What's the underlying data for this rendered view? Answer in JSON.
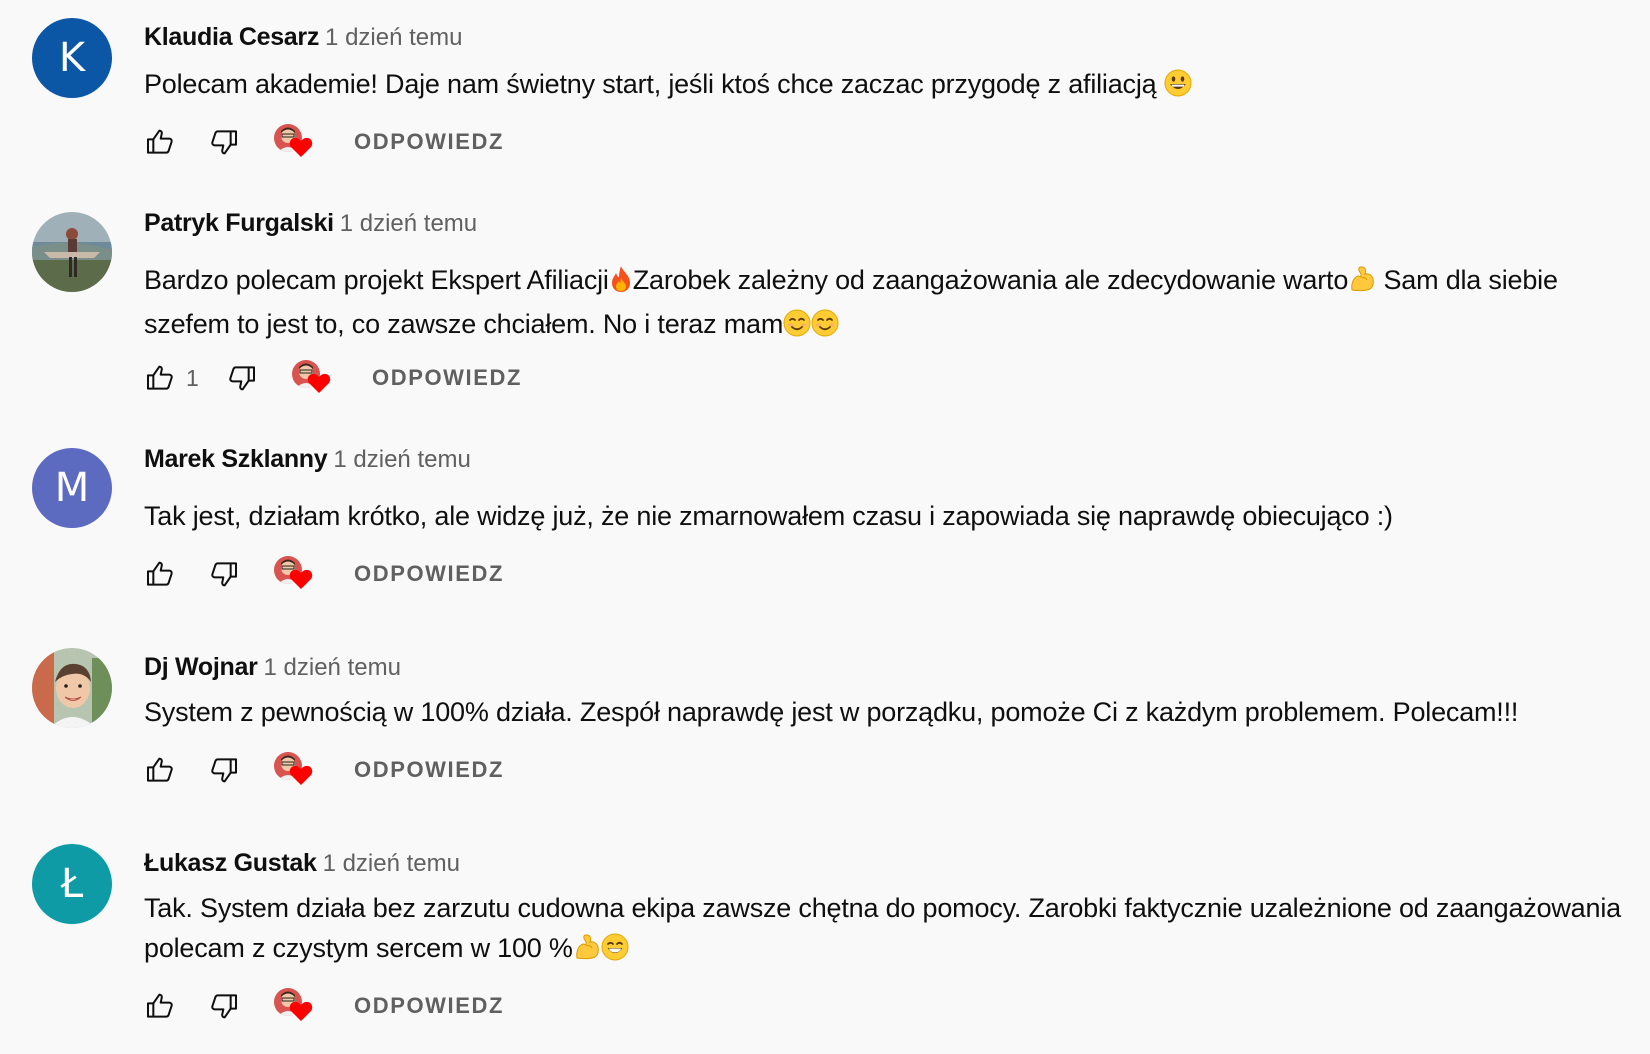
{
  "reply_label": "ODPOWIEDZ",
  "colors": {
    "background": "#f9f9f9",
    "text_primary": "#0f0f0f",
    "text_secondary": "#606060",
    "heart": "#ff0000"
  },
  "comments": [
    {
      "author": "Klaudia Cesarz",
      "time": "1 dzień temu",
      "avatar_letter": "K",
      "avatar_color": "#0b57a6",
      "text_parts": [
        "Polecam akademie! Daje nam świetny start, jeśli ktoś chce zaczac przygodę z afiliacją "
      ],
      "emojis": [
        "grinning-face"
      ],
      "likes": ""
    },
    {
      "author": "Patryk Furgalski",
      "time": "1 dzień temu",
      "avatar_letter": "",
      "avatar_color": "#6b7a6a",
      "text_parts": [
        "Bardzo polecam projekt Ekspert Afiliacji",
        "Zarobek zależny od zaangażowania ale zdecydowanie warto",
        " Sam dla siebie szefem to jest to, co zawsze chciałem. No i teraz mam"
      ],
      "emojis": [
        "fire",
        "flexed-biceps",
        "smiling-face",
        "smiling-face"
      ],
      "likes": "1"
    },
    {
      "author": "Marek Szklanny",
      "time": "1 dzień temu",
      "avatar_letter": "M",
      "avatar_color": "#5c6bc0",
      "text_parts": [
        "Tak jest, działam krótko, ale widzę już, że nie zmarnowałem czasu i zapowiada się naprawdę obiecująco :)"
      ],
      "emojis": [],
      "likes": ""
    },
    {
      "author": "Dj Wojnar",
      "time": "1 dzień temu",
      "avatar_letter": "",
      "avatar_color": "#8a9a7a",
      "text_parts": [
        "System z pewnością w 100% działa. Zespół naprawdę jest w porządku, pomoże Ci z każdym problemem. Polecam!!!"
      ],
      "emojis": [],
      "likes": ""
    },
    {
      "author": "Łukasz Gustak",
      "time": "1 dzień temu",
      "avatar_letter": "Ł",
      "avatar_color": "#0e9ba6",
      "text_parts": [
        "Tak. System działa bez zarzutu cudowna ekipa zawsze chętna do pomocy.  Zarobki faktycznie uzależnione od zaangażowania polecam z czystym sercem w 100 %"
      ],
      "emojis": [
        "flexed-biceps",
        "beaming-face"
      ],
      "likes": ""
    }
  ]
}
